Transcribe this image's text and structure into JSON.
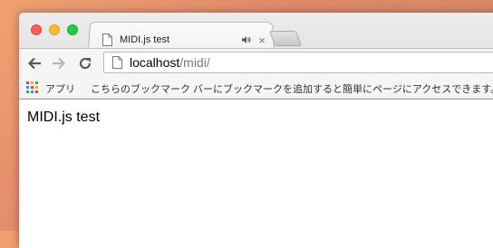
{
  "tab": {
    "title": "MIDI.js test",
    "close": "×"
  },
  "address_bar": {
    "host": "localhost",
    "path": "/midi/"
  },
  "bookmarks_bar": {
    "apps_label": "アプリ",
    "message": "こちらのブックマーク バーにブックマークを追加すると簡単にページにアクセスできます。"
  },
  "page": {
    "text": "MIDI.js test"
  },
  "colors": {
    "close": "#fc5f57",
    "minimize": "#fdbc2e",
    "maximize": "#28c840",
    "apps": [
      "#e94235",
      "#f4b400",
      "#34a853",
      "#4285f4",
      "#e94235",
      "#f4b400",
      "#34a853",
      "#4285f4",
      "#e94235"
    ]
  },
  "icons": [
    "document-icon",
    "speaker-icon",
    "back-icon",
    "forward-icon",
    "reload-icon",
    "apps-grid-icon"
  ]
}
